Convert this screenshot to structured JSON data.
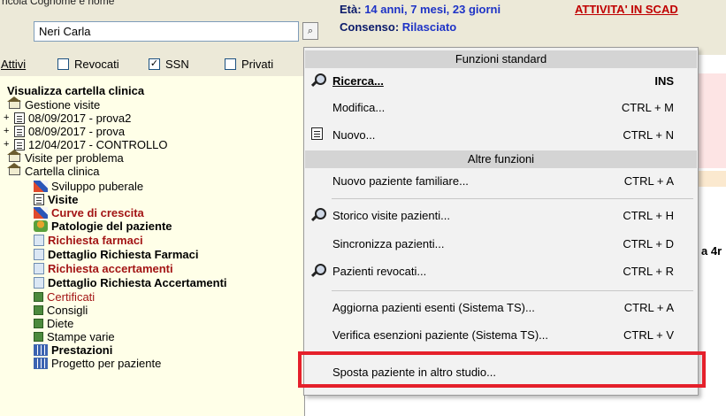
{
  "header": {
    "cut_label": "ricola   Cognome e nome",
    "patient_name": "Neri Carla",
    "lookup_glyph": "⌕",
    "age_label": "Età:",
    "age_value": "14 anni, 7 mesi, 23 giorni",
    "consent_label": "Consenso:",
    "consent_value": "Rilasciato",
    "alert": "ATTIVITA' IN SCAD"
  },
  "filters": [
    {
      "label": "Attivi",
      "checked": null
    },
    {
      "label": "Revocati",
      "checked": false
    },
    {
      "label": "SSN",
      "checked": true
    },
    {
      "label": "Privati",
      "checked": false
    }
  ],
  "tree": {
    "title": "Visualizza cartella clinica",
    "gestione_visite": "Gestione visite",
    "visits": [
      "08/09/2017 - prova2",
      "08/09/2017 - prova",
      "12/04/2017 - CONTROLLO"
    ],
    "visite_problema": "Visite per problema",
    "cartella": "Cartella clinica",
    "children": [
      "Sviluppo puberale",
      "Visite",
      "Curve di crescita",
      "Patologie del paziente",
      "Richiesta farmaci",
      "Dettaglio Richiesta Farmaci",
      "Richiesta accertamenti",
      "Dettaglio Richiesta Accertamenti",
      "Certificati",
      "Consigli",
      "Diete",
      "Stampe varie",
      "Prestazioni",
      "Progetto per paziente"
    ]
  },
  "side_fragment": "a 4r",
  "menu": {
    "header_standard": "Funzioni standard",
    "header_other": "Altre funzioni",
    "items": [
      {
        "label": "Ricerca...",
        "shortcut": "INS",
        "icon": "magnifier-icon"
      },
      {
        "label": "Modifica...",
        "shortcut": "CTRL + M"
      },
      {
        "label": "Nuovo...",
        "shortcut": "CTRL + N",
        "icon": "new-document-icon"
      },
      {
        "label": "Nuovo paziente familiare...",
        "shortcut": "CTRL + A"
      },
      {
        "label": "Storico visite pazienti...",
        "shortcut": "CTRL + H",
        "icon": "magnifier-icon"
      },
      {
        "label": "Sincronizza pazienti...",
        "shortcut": "CTRL + D"
      },
      {
        "label": "Pazienti revocati...",
        "shortcut": "CTRL + R",
        "icon": "magnifier-icon"
      },
      {
        "label": "Aggiorna pazienti esenti (Sistema TS)...",
        "shortcut": "CTRL + A"
      },
      {
        "label": "Verifica esenzioni paziente (Sistema TS)...",
        "shortcut": "CTRL + V"
      },
      {
        "label": "Sposta paziente in altro studio...",
        "shortcut": ""
      }
    ]
  },
  "colors": {
    "highlight": "#e5202b",
    "alert": "#c00000",
    "info_blue": "#1e33c6"
  }
}
